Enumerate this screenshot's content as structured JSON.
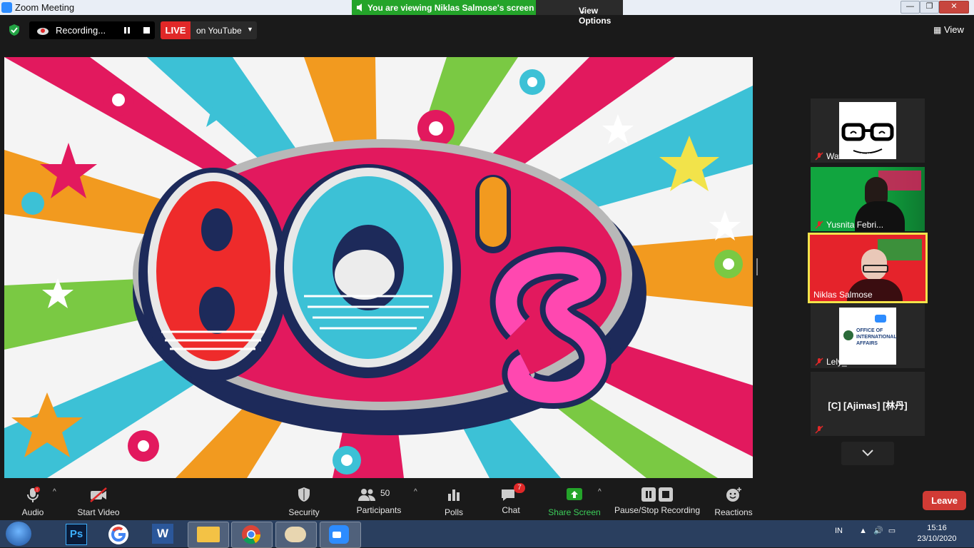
{
  "window": {
    "title": "Zoom Meeting",
    "viewing_banner": "You are viewing Niklas Salmose's screen",
    "view_options": "View Options",
    "controls": [
      "—",
      "❐",
      "✕"
    ]
  },
  "meeting_bar": {
    "recording_label": "Recording...",
    "live_badge": "LIVE",
    "live_target": "on YouTube",
    "view_label": "View"
  },
  "shared_screen": {
    "artwork_text": "80's"
  },
  "participants_panel": {
    "tiles": [
      {
        "name": "Wawan Yulia..."
      },
      {
        "name": "Yusnita Febri..."
      },
      {
        "name": "Niklas Salmose"
      },
      {
        "name": "Lely_OIA HI U..."
      },
      {
        "name": "[C] [Ajimas] [林丹]"
      }
    ],
    "oia_logo_text": "OFFICE OF INTERNATIONAL AFFAIRS"
  },
  "toolbar": {
    "audio": "Audio",
    "start_video": "Start Video",
    "security": "Security",
    "participants": "Participants",
    "participants_count": "50",
    "polls": "Polls",
    "chat": "Chat",
    "chat_badge": "7",
    "share_screen": "Share Screen",
    "pause_stop_recording": "Pause/Stop Recording",
    "reactions": "Reactions",
    "leave": "Leave"
  },
  "taskbar": {
    "apps": [
      "Photoshop",
      "Google",
      "Word",
      "File Explorer",
      "Chrome",
      "Paint",
      "Zoom"
    ],
    "ps_label": "Ps",
    "input_lang": "IN",
    "time": "15:16",
    "date": "23/10/2020"
  },
  "colors": {
    "zoom_blue": "#2d8cff",
    "live_red": "#e02828",
    "share_green": "#24a42a",
    "leave_red": "#d13b35",
    "active_speaker": "#f2e34a"
  }
}
